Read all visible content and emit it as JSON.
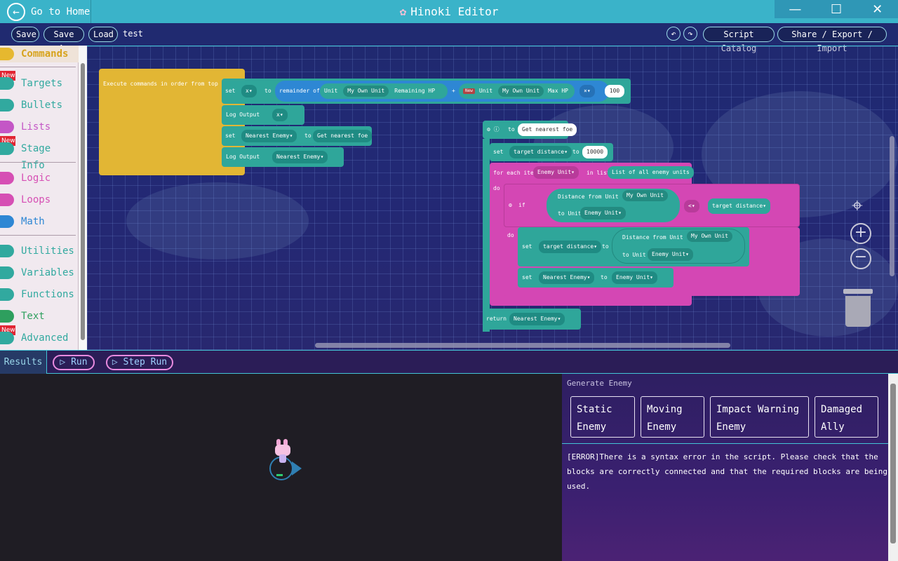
{
  "window": {
    "title": "Hinoki Editor",
    "home_label": "Go to Home",
    "controls": {
      "minimize": "—",
      "maximize": "☐",
      "close": "✕"
    }
  },
  "toolbar": {
    "save": "Save",
    "save_as": "Save As",
    "load": "Load",
    "script_name": "test",
    "undo": "↶",
    "redo": "↷",
    "script_catalog": "Script Catalog",
    "share": "Share / Export / Import"
  },
  "sidebar": {
    "new_badge": "New",
    "items": [
      {
        "label": "Commands",
        "color": "#e6b82f"
      },
      {
        "label": "Targets",
        "color": "#31a99f"
      },
      {
        "label": "Bullets",
        "color": "#31a99f"
      },
      {
        "label": "Lists",
        "color": "#c456c6"
      },
      {
        "label": "Stage Info",
        "color": "#31a99f"
      },
      {
        "label": "Logic",
        "color": "#d64fb4"
      },
      {
        "label": "Loops",
        "color": "#d64fb4"
      },
      {
        "label": "Math",
        "color": "#2e87d4"
      },
      {
        "label": "Utilities",
        "color": "#31a99f"
      },
      {
        "label": "Variables",
        "color": "#31a99f"
      },
      {
        "label": "Functions",
        "color": "#31a99f"
      },
      {
        "label": "Text",
        "color": "#2e9f5e"
      },
      {
        "label": "Advanced",
        "color": "#31a99f"
      }
    ]
  },
  "blocks": {
    "main_head": "Execute commands in order from top",
    "set": "set",
    "to": "to",
    "x_var": "x",
    "remainder_of": "remainder of",
    "unit": "Unit",
    "my_own_unit": "My Own Unit",
    "remaining_hp": "Remaining HP",
    "plus": "+",
    "new_tag": "New",
    "max_hp": "Max HP",
    "times": "×",
    "hundred": "100",
    "log_output": "Log Output",
    "nearest_enemy": "Nearest Enemy",
    "get_nearest_foe": "Get nearest foe",
    "fn_to": "to",
    "target_distance": "target distance",
    "ten_thousand": "10000",
    "for_each_item": "for each item",
    "enemy_unit": "Enemy Unit",
    "in_list": "in list",
    "all_enemy_units": "List of all enemy units",
    "do": "do",
    "if": "if",
    "distance_from_unit": "Distance from Unit",
    "to_unit": "to Unit",
    "less_than": "<",
    "return": "return"
  },
  "results": {
    "tab": "Results",
    "run": "Run",
    "step_run": "Step Run"
  },
  "panel": {
    "title": "Generate Enemy",
    "buttons": [
      {
        "line1": "Static",
        "line2": "Enemy"
      },
      {
        "line1": "Moving",
        "line2": "Enemy"
      },
      {
        "line1": "Impact Warning",
        "line2": "Enemy"
      },
      {
        "line1": "Damaged",
        "line2": "Ally"
      }
    ],
    "error": "[ERROR]There is a syntax error in the script. Please check that the blocks are correctly connected and that the required blocks are being used."
  },
  "colors": {
    "titlebar": "#3ab3c9",
    "accent": "#43c4d6",
    "commands_block": "#e2b634",
    "teal_block": "#2fa69a",
    "logic_block": "#d447b4"
  }
}
